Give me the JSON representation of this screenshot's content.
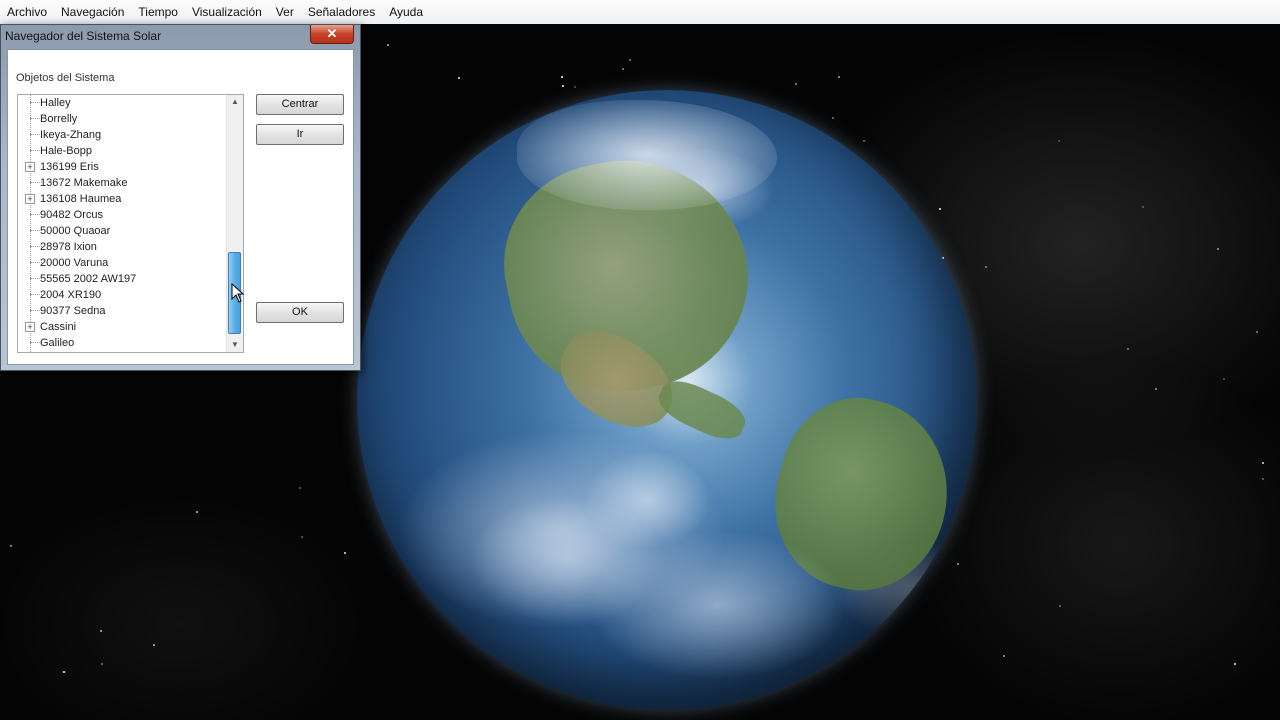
{
  "menu": [
    "Archivo",
    "Navegación",
    "Tiempo",
    "Visualización",
    "Ver",
    "Señaladores",
    "Ayuda"
  ],
  "dialog": {
    "title": "Navegador del Sistema Solar",
    "close_glyph": "✕",
    "group_label": "Objetos del Sistema",
    "tree_items": [
      {
        "label": "Halley",
        "expandable": false
      },
      {
        "label": "Borrelly",
        "expandable": false
      },
      {
        "label": "Ikeya-Zhang",
        "expandable": false
      },
      {
        "label": "Hale-Bopp",
        "expandable": false
      },
      {
        "label": "136199 Eris",
        "expandable": true
      },
      {
        "label": "13672 Makemake",
        "expandable": false
      },
      {
        "label": "136108 Haumea",
        "expandable": true
      },
      {
        "label": "90482 Orcus",
        "expandable": false
      },
      {
        "label": "50000 Quaoar",
        "expandable": false
      },
      {
        "label": "28978 Ixion",
        "expandable": false
      },
      {
        "label": "20000 Varuna",
        "expandable": false
      },
      {
        "label": "55565 2002 AW197",
        "expandable": false
      },
      {
        "label": "2004 XR190",
        "expandable": false
      },
      {
        "label": "90377 Sedna",
        "expandable": false
      },
      {
        "label": "Cassini",
        "expandable": true
      },
      {
        "label": "Galileo",
        "expandable": false
      }
    ],
    "expander_glyph": "+",
    "scroll_up_glyph": "▲",
    "scroll_down_glyph": "▼",
    "buttons": {
      "center": "Centrar",
      "go": "Ir",
      "ok": "OK"
    }
  },
  "icons": {
    "cursor": "arrow-pointer-icon"
  }
}
